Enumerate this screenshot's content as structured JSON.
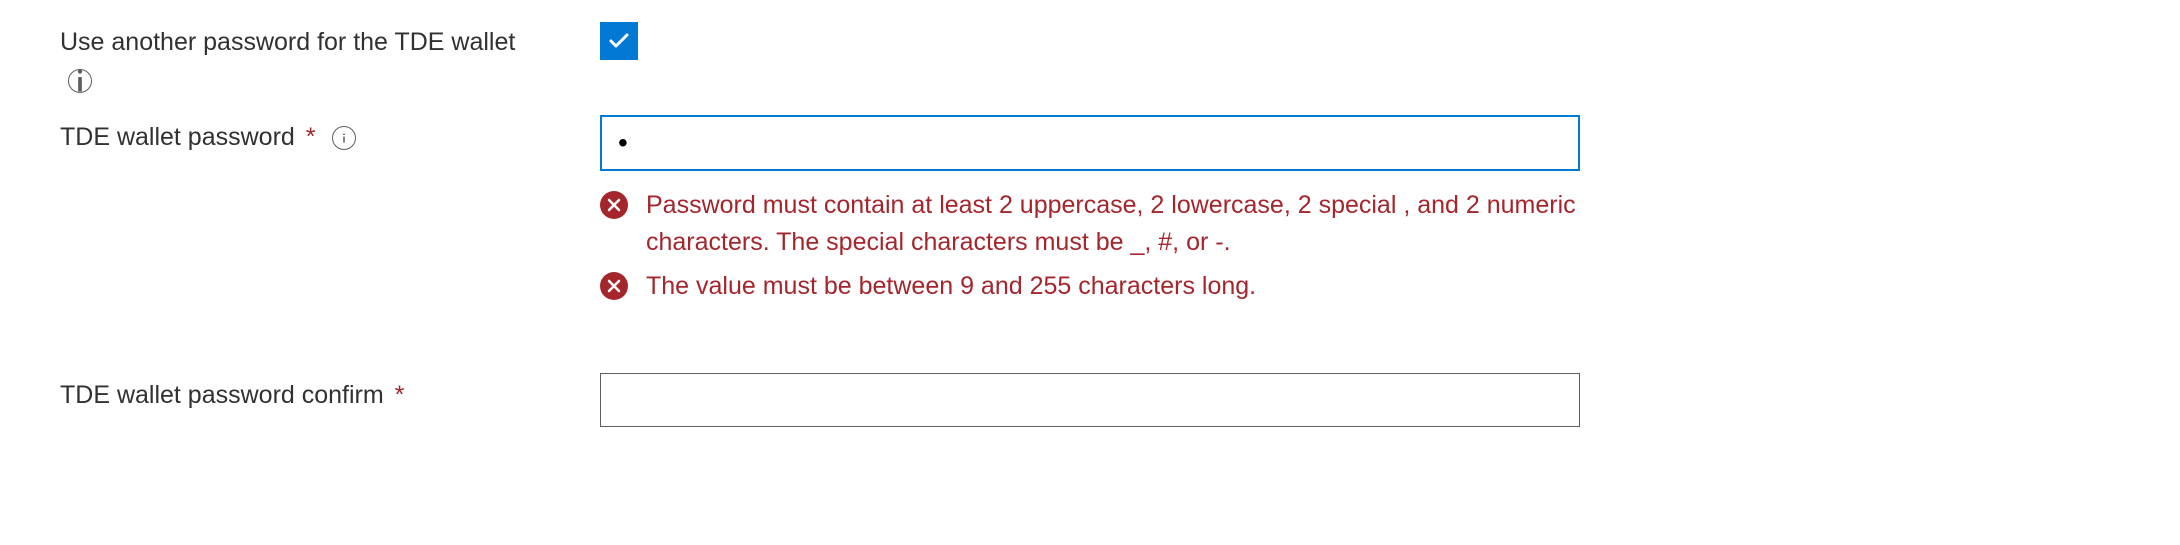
{
  "fields": {
    "use_another_password": {
      "label": "Use another password for the TDE wallet",
      "checked": true
    },
    "tde_password": {
      "label": "TDE wallet password",
      "required_marker": "*",
      "value": "•",
      "errors": [
        "Password must contain at least 2 uppercase, 2 lowercase, 2 special , and 2 numeric characters. The special characters must be _, #, or -.",
        "The value must be between 9 and 255 characters long."
      ]
    },
    "tde_password_confirm": {
      "label": "TDE wallet password confirm",
      "required_marker": "*",
      "value": ""
    }
  },
  "colors": {
    "accent": "#0078d4",
    "error": "#a4262c",
    "text": "#323130",
    "border": "#605e5c"
  }
}
